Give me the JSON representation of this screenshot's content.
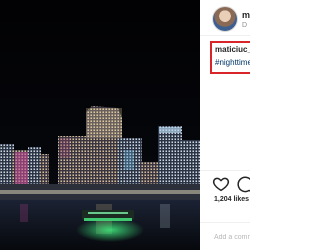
{
  "post": {
    "author": {
      "username": "m",
      "posted_fragment": "D"
    },
    "caption": {
      "username": "maticiuc_",
      "hashtag": "#nighttime"
    },
    "likes": "1,204 likes",
    "comment_placeholder": "Add a comment..."
  },
  "icons": {
    "like": "heart-icon",
    "comment": "comment-icon",
    "avatar": "profile-photo"
  },
  "colors": {
    "caption_highlight": "#d9252a",
    "hashtag": "#003569",
    "text": "#262626",
    "muted": "#8e8e8e"
  }
}
